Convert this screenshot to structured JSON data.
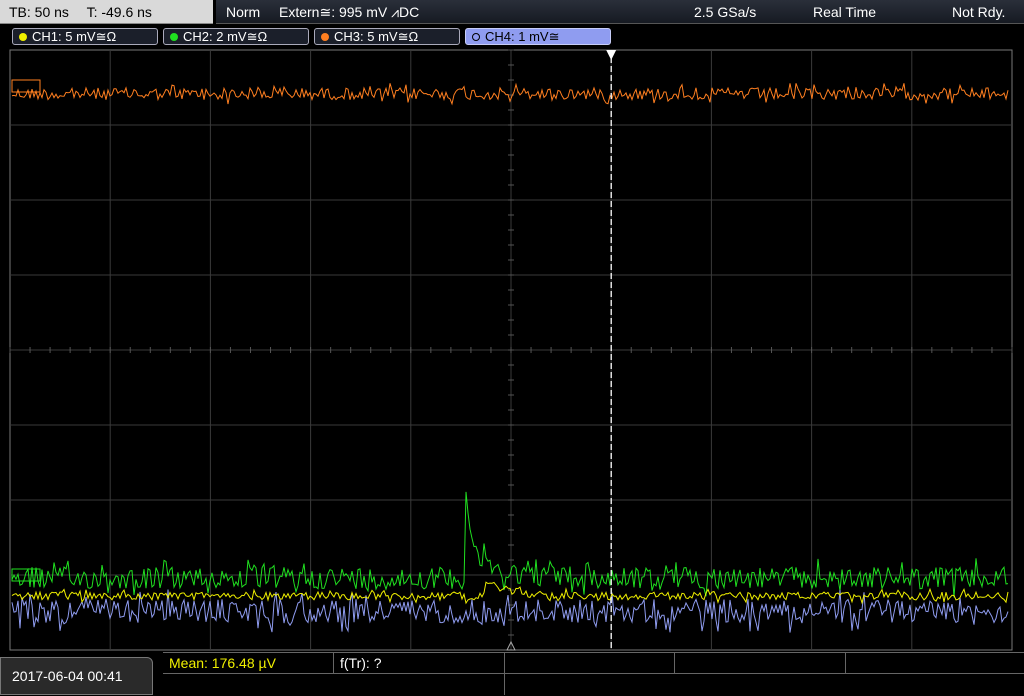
{
  "status": {
    "timebase": "TB: 50 ns",
    "trigger_time": "T: -49.6 ns",
    "mode": "Norm",
    "trigger_source": "Extern≅: 995 mV ⩘DC",
    "sample_rate": "2.5 GSa/s",
    "acquisition": "Real Time",
    "state": "Not Rdy."
  },
  "channels": [
    {
      "label": "CH1: 5 mV≅Ω",
      "color": "#f0f000"
    },
    {
      "label": "CH2: 2 mV≅Ω",
      "color": "#20e020"
    },
    {
      "label": "CH3: 5 mV≅Ω",
      "color": "#ff7f20"
    },
    {
      "label": "CH4: 1 mV≅",
      "color": "#8f9cf0"
    }
  ],
  "traces": {
    "ch3_level": 0.073,
    "ch2_level": 0.88,
    "ch1_level": 0.91,
    "ch4_level": 0.935,
    "pulse_position": 0.455,
    "trigger_position": 0.6
  },
  "measurement": {
    "mean": "Mean: 176.48 µV",
    "ftr": "f(Tr): ?"
  },
  "datetime": "2017-06-04 00:41"
}
